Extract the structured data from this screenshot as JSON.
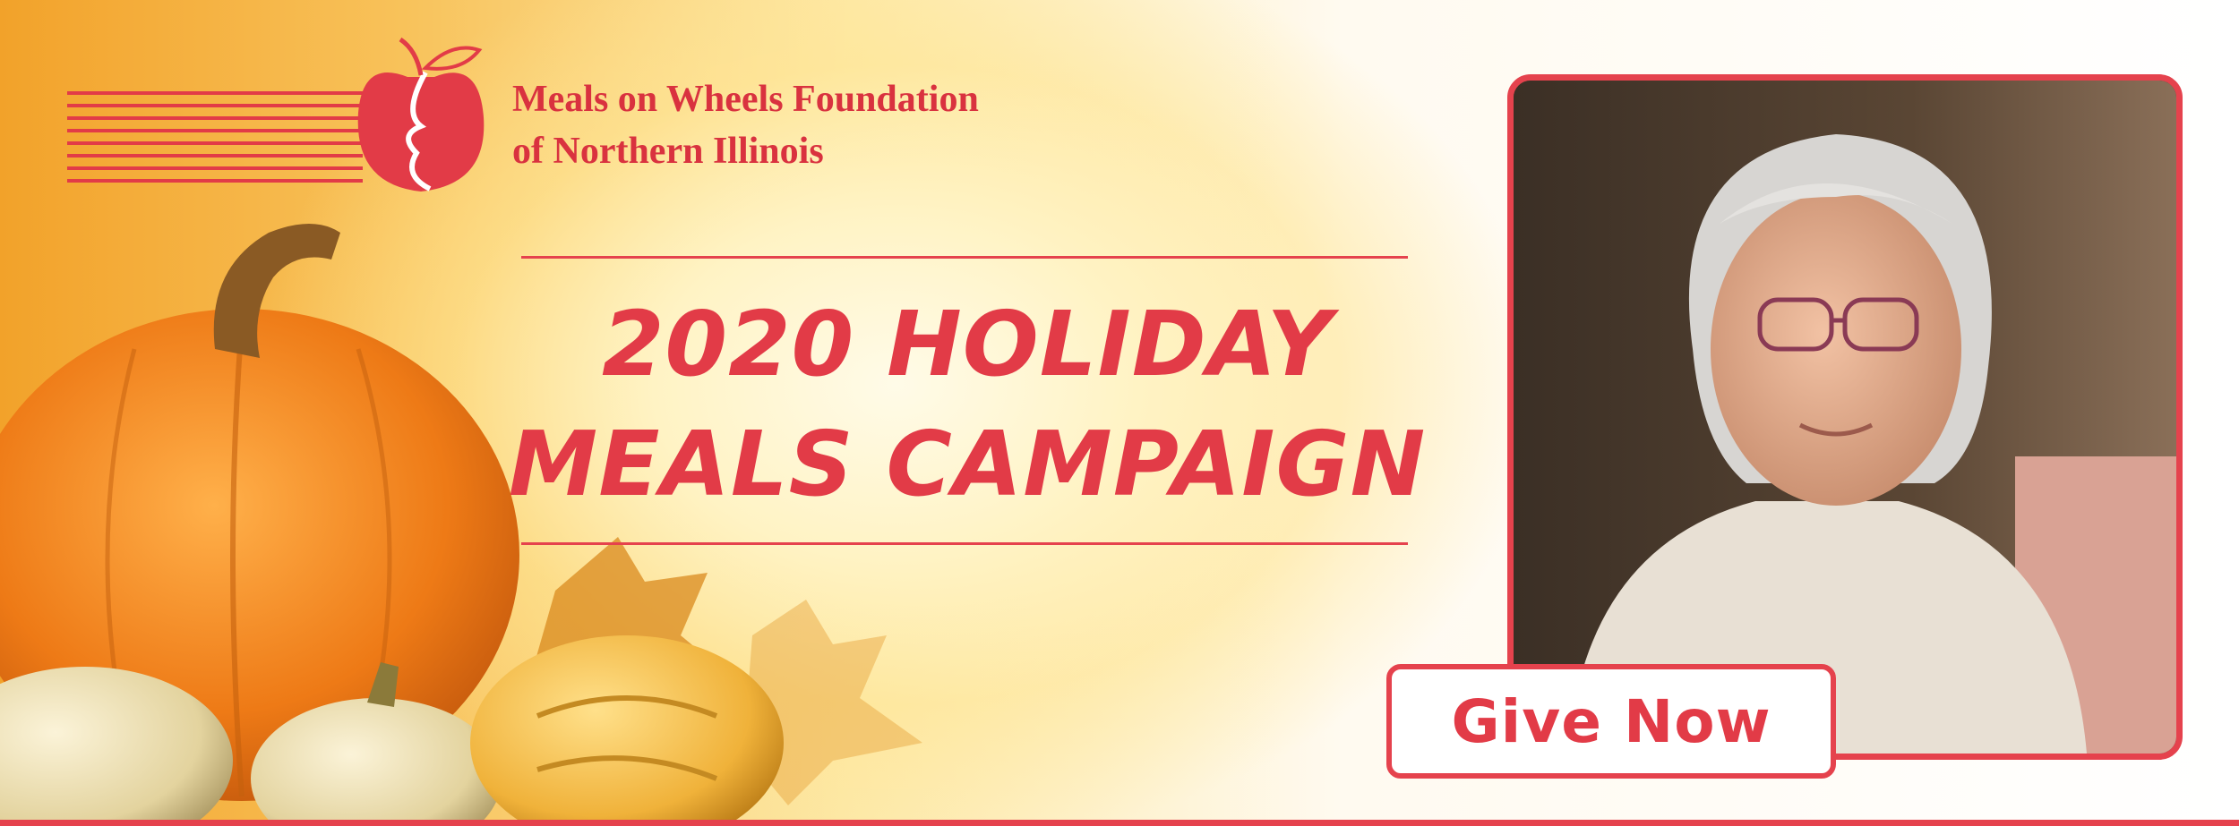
{
  "organization": {
    "name_line1": "Meals on Wheels Foundation",
    "name_line2": "of Northern Illinois",
    "logo_icon": "apple-with-profile-speed-lines-icon"
  },
  "campaign": {
    "title_line1": "2020 HOLIDAY",
    "title_line2": "MEALS CAMPAIGN"
  },
  "cta": {
    "label": "Give Now"
  },
  "images": {
    "photo": "elderly-woman-portrait",
    "decor": "pumpkin-gourds-autumn-leaves"
  },
  "colors": {
    "brand_red": "#e23b47",
    "background_warm": "#f8c25a",
    "pumpkin": "#ee7a16"
  }
}
